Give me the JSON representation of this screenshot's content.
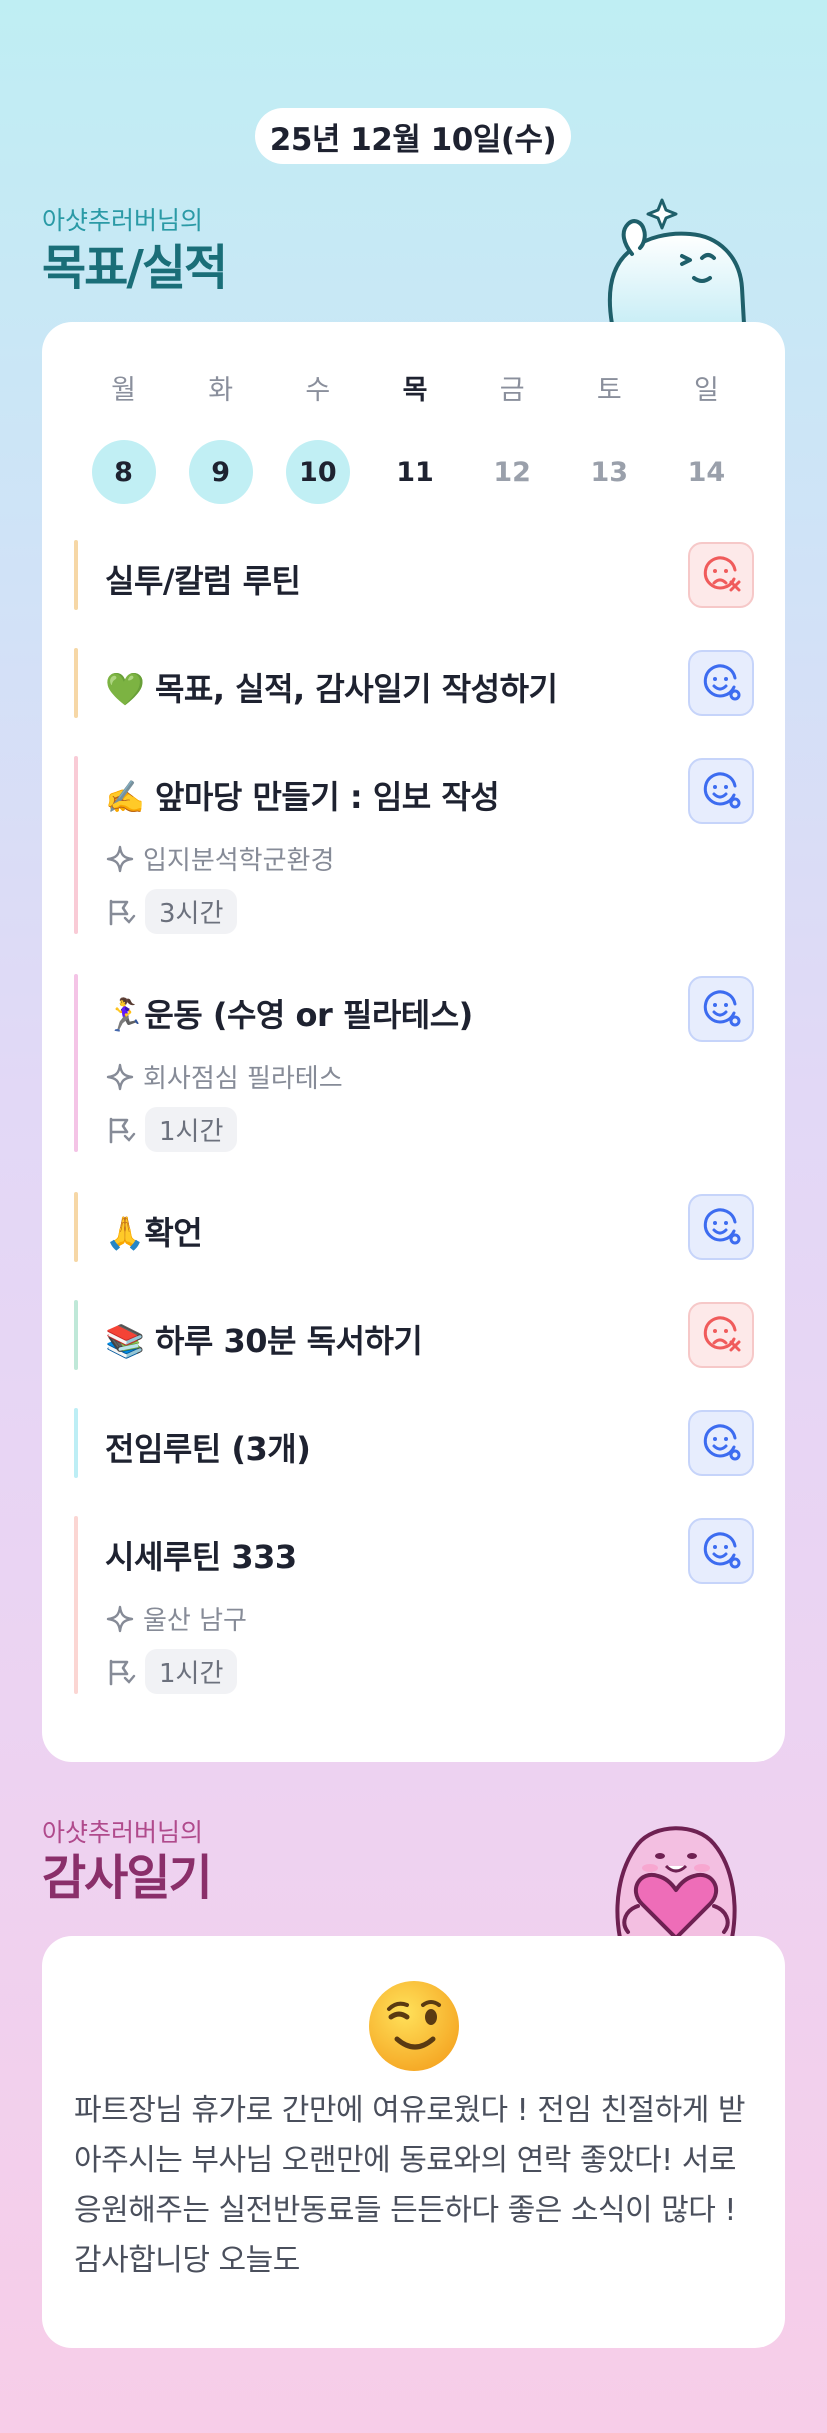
{
  "date_pill": "25년 12월 10일(수)",
  "goals": {
    "subtitle": "아샷추러버님의",
    "title": "목표/실적",
    "days": [
      {
        "name": "월",
        "num": "8",
        "state": "done"
      },
      {
        "name": "화",
        "num": "9",
        "state": "done"
      },
      {
        "name": "수",
        "num": "10",
        "state": "done"
      },
      {
        "name": "목",
        "num": "11",
        "state": "today"
      },
      {
        "name": "금",
        "num": "12",
        "state": "future"
      },
      {
        "name": "토",
        "num": "13",
        "state": "future"
      },
      {
        "name": "일",
        "num": "14",
        "state": "future"
      }
    ],
    "tasks": [
      {
        "title": "실투/칼럼 루틴",
        "status": "no",
        "bar_color": "#f6d7a6"
      },
      {
        "title": "💚 목표, 실적, 감사일기 작성하기",
        "status": "ok",
        "bar_color": "#f6d7a6"
      },
      {
        "title": "✍️ 앞마당 만들기 : 임보 작성",
        "status": "ok",
        "bar_color": "#f9cbd6",
        "meta": "입지분석학군환경",
        "time": "3시간"
      },
      {
        "title": "🏃‍♀️운동 (수영 or 필라테스)",
        "status": "ok",
        "bar_color": "#f4c4e6",
        "meta": "회사점심 필라테스",
        "time": "1시간"
      },
      {
        "title": "🙏확언",
        "status": "ok",
        "bar_color": "#f6d7a6"
      },
      {
        "title": "📚 하루 30분 독서하기",
        "status": "no",
        "bar_color": "#bfe8d8"
      },
      {
        "title": "전임루틴 (3개)",
        "status": "ok",
        "bar_color": "#bdeef5"
      },
      {
        "title": "시세루틴 333",
        "status": "ok",
        "bar_color": "#fbd6d3",
        "meta": "울산 남구",
        "time": "1시간"
      }
    ]
  },
  "gratitude": {
    "subtitle": "아샷추러버님의",
    "title": "감사일기",
    "text": "파트장님 휴가로 간만에 여유로웠다 ! 전임 친절하게 받아주시는 부사님 오랜만에 동료와의 연락 좋았다! 서로 응원해주는 실전반동료들 든든하다 좋은 소식이 많다 ! 감사합니당 오늘도"
  },
  "colors": {
    "ok": "#3d6cf0",
    "no": "#f05b5b",
    "accent_teal": "#1a6e78",
    "accent_pink": "#8a2f6a"
  }
}
